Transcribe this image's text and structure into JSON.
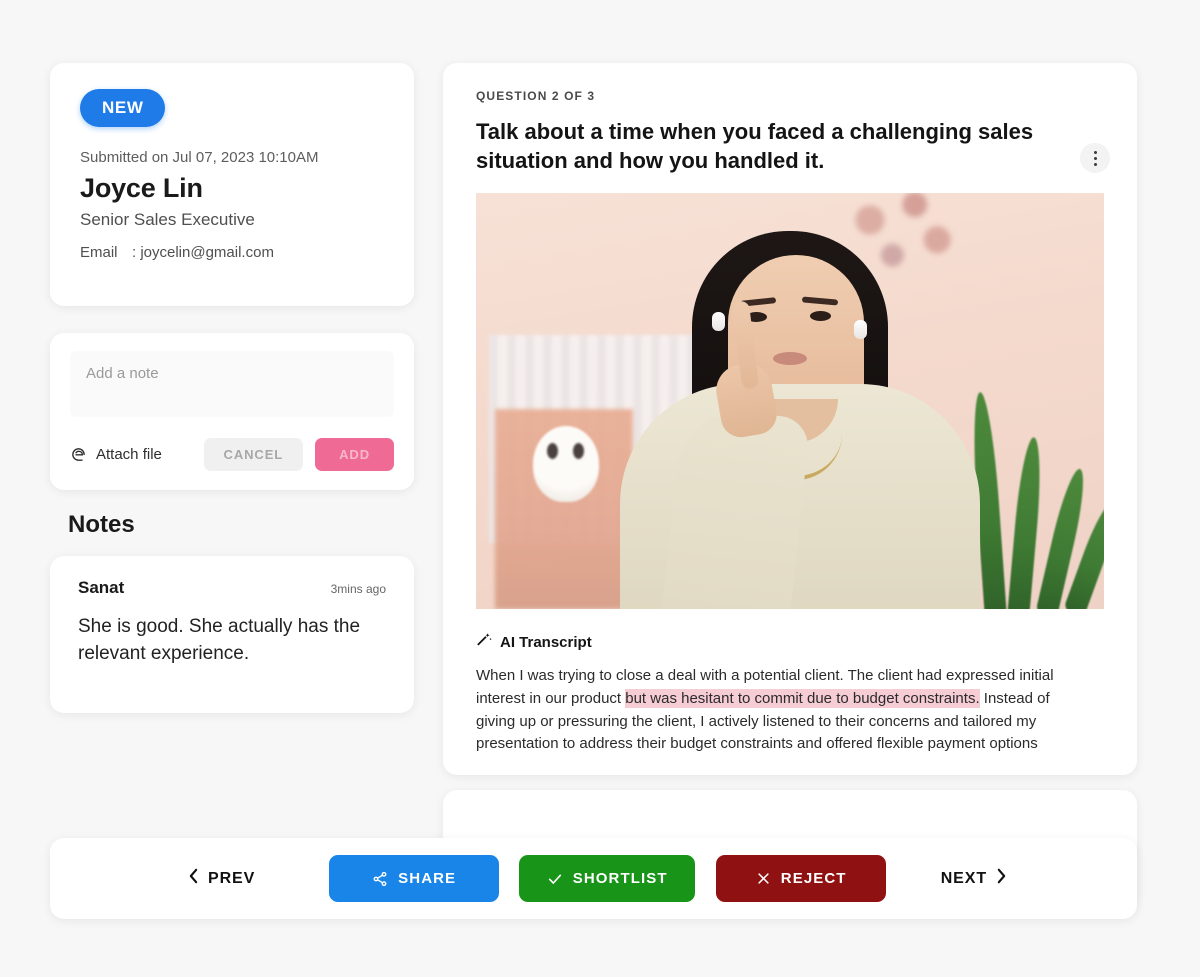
{
  "candidate": {
    "badge": "NEW",
    "submitted": "Submitted on Jul 07, 2023 10:10AM",
    "name": "Joyce Lin",
    "role": "Senior Sales Executive",
    "email_label": "Email",
    "email_value": ": joycelin@gmail.com"
  },
  "note_compose": {
    "placeholder": "Add a note",
    "value": "",
    "attach_label": "Attach file",
    "cancel_label": "CANCEL",
    "add_label": "ADD"
  },
  "notes": {
    "heading": "Notes",
    "items": [
      {
        "author": "Sanat",
        "time": "3mins ago",
        "body": "She is good. She actually has the relevant experience."
      }
    ]
  },
  "question": {
    "index_label": "QUESTION 2 OF 3",
    "text": "Talk about a time when you faced a challenging sales situation and how you handled it."
  },
  "transcript": {
    "title": "AI Transcript",
    "before": "When I was trying to close a deal with a potential client. The client had expressed initial interest in our product ",
    "highlight": "but was hesitant to commit due to budget constraints.",
    "after": " Instead of giving up or pressuring the client, I actively listened to their concerns and tailored my presentation to address their budget constraints and offered flexible payment options"
  },
  "actions": {
    "prev_label": "PREV",
    "share_label": "SHARE",
    "shortlist_label": "SHORTLIST",
    "reject_label": "REJECT",
    "next_label": "NEXT"
  },
  "colors": {
    "badge_blue": "#1E7BE8",
    "share_blue": "#1A85E8",
    "shortlist_green": "#189418",
    "reject_red": "#8F1111",
    "add_pink": "#F06A96",
    "highlight_pink": "#F6CCD5",
    "page_bg": "#F7F7F7"
  }
}
